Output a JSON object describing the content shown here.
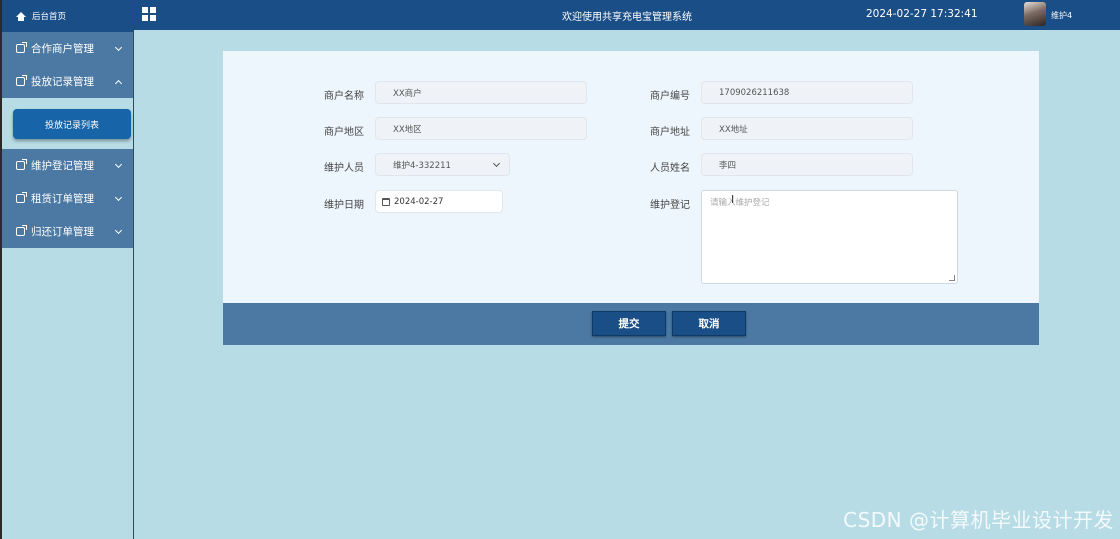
{
  "header": {
    "title": "欢迎使用共享充电宝管理系统",
    "datetime": "2024-02-27 17:32:41",
    "username": "维护4"
  },
  "sidebar": {
    "home_label": "后台首页",
    "items": [
      {
        "label": "合作商户管理",
        "expanded": false
      },
      {
        "label": "投放记录管理",
        "expanded": true
      },
      {
        "label": "维护登记管理",
        "expanded": false
      },
      {
        "label": "租赁订单管理",
        "expanded": false
      },
      {
        "label": "归还订单管理",
        "expanded": false
      }
    ],
    "sub_active": "投放记录列表"
  },
  "form": {
    "merchant_name_label": "商户名称",
    "merchant_name_value": "XX商户",
    "merchant_no_label": "商户编号",
    "merchant_no_value": "1709026211638",
    "merchant_region_label": "商户地区",
    "merchant_region_value": "XX地区",
    "merchant_address_label": "商户地址",
    "merchant_address_value": "XX地址",
    "maintainer_label": "维护人员",
    "maintainer_value": "维护4-332211",
    "person_name_label": "人员姓名",
    "person_name_value": "李四",
    "date_label": "维护日期",
    "date_value": "2024-02-27",
    "record_label": "维护登记",
    "record_placeholder": "请输入维护登记"
  },
  "actions": {
    "submit_label": "提交",
    "cancel_label": "取消"
  },
  "watermark": "CSDN @计算机毕业设计开发",
  "colors": {
    "header_bg": "#1a4e86",
    "menu_bg": "#4b79a3",
    "page_bg": "#b7dce6",
    "active_sub": "#1765a8"
  }
}
